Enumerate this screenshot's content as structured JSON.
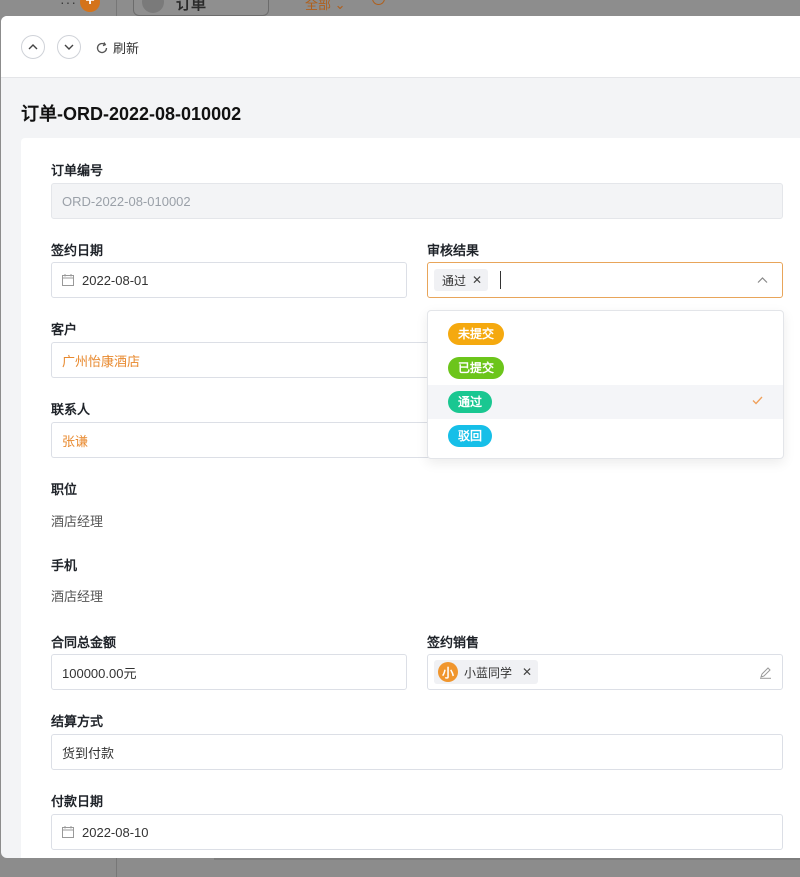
{
  "background": {
    "more_glyph": "···",
    "plus_glyph": "+",
    "tab_label": "订单",
    "filter_label": "全部 ⌄"
  },
  "toolbar": {
    "refresh_label": "刷新"
  },
  "page": {
    "title": "订单-ORD-2022-08-010002"
  },
  "form": {
    "order_no": {
      "label": "订单编号",
      "value": "ORD-2022-08-010002"
    },
    "sign_date": {
      "label": "签约日期",
      "value": "2022-08-01"
    },
    "review": {
      "label": "审核结果",
      "selected_tag": "通过",
      "remove_glyph": "✕"
    },
    "customer": {
      "label": "客户",
      "value": "广州怡康酒店"
    },
    "contact": {
      "label": "联系人",
      "value": "张谦"
    },
    "position": {
      "label": "职位",
      "value": "酒店经理"
    },
    "phone": {
      "label": "手机",
      "value": "酒店经理"
    },
    "amount": {
      "label": "合同总金额",
      "value": "100000.00元"
    },
    "sales": {
      "label": "签约销售",
      "avatar_text": "小",
      "name": "小蓝同学",
      "remove_glyph": "✕"
    },
    "settlement": {
      "label": "结算方式",
      "value": "货到付款"
    },
    "pay_date": {
      "label": "付款日期",
      "value": "2022-08-10"
    }
  },
  "dropdown": {
    "options": [
      {
        "label": "未提交",
        "color": "#f5a90f"
      },
      {
        "label": "已提交",
        "color": "#6cc51b"
      },
      {
        "label": "通过",
        "color": "#1ac791"
      },
      {
        "label": "驳回",
        "color": "#16bfe8"
      }
    ],
    "selected_index": 2
  },
  "colors": {
    "accent": "#e8892e",
    "check": "#f0a05a"
  }
}
